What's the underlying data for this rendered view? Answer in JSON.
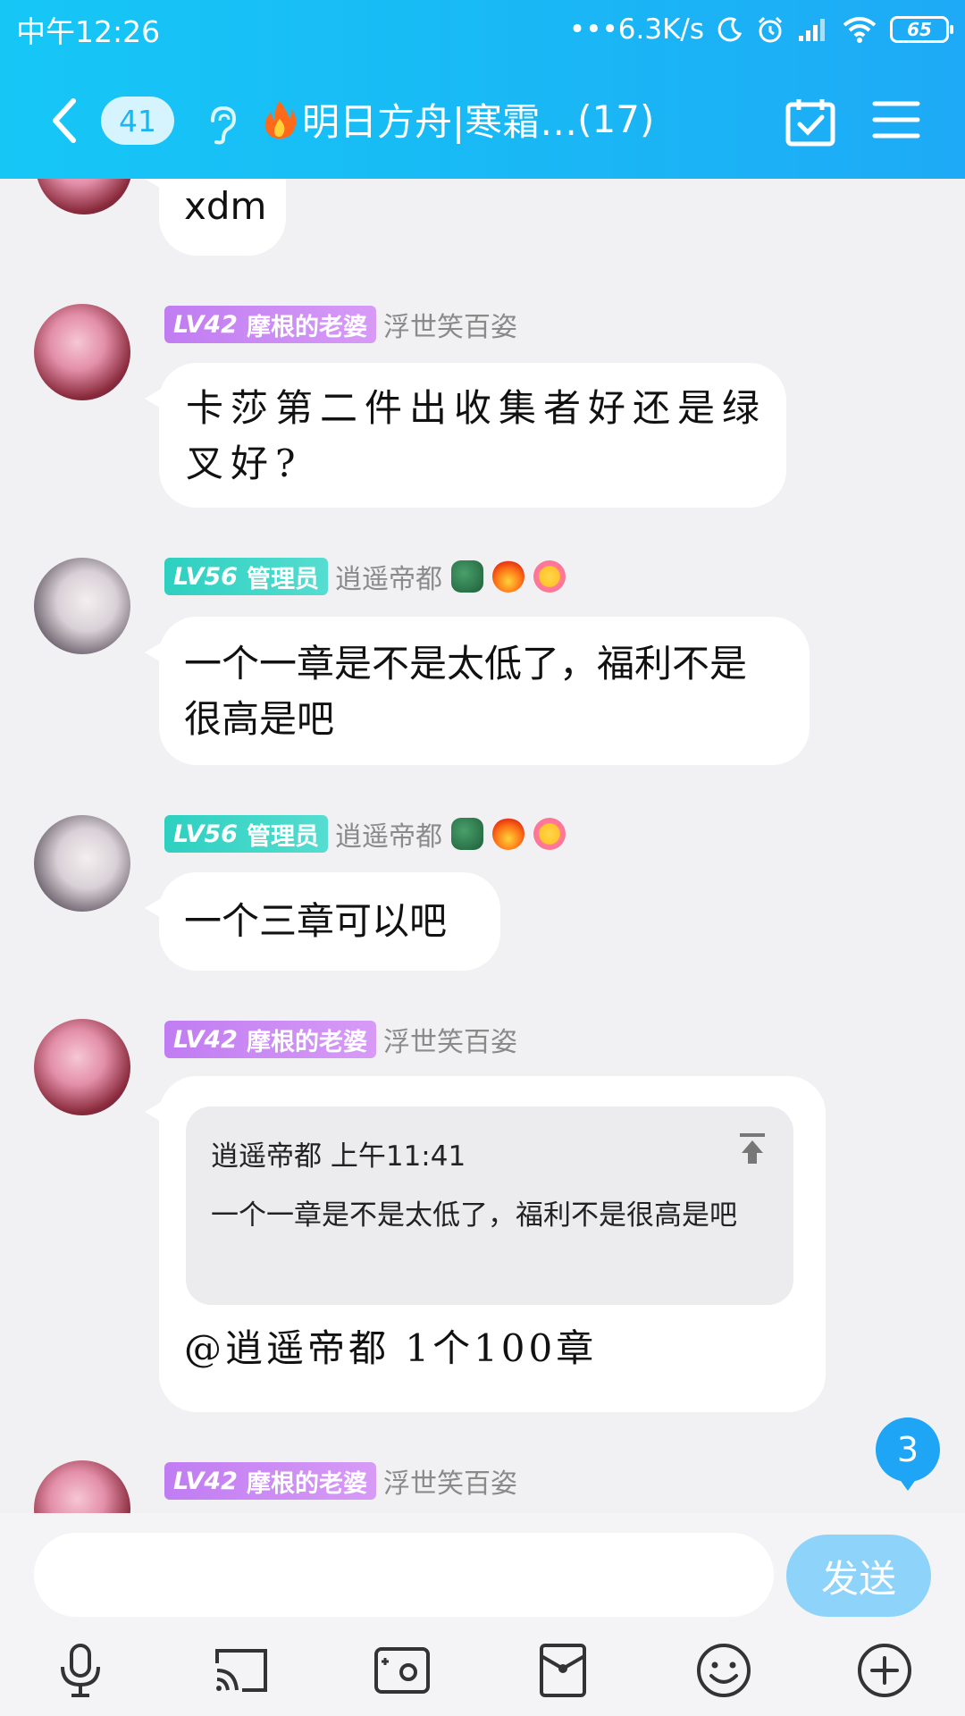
{
  "status_bar": {
    "time": "中午12:26",
    "net_speed": "6.3K/s",
    "battery": "65"
  },
  "header": {
    "unread_count": "41",
    "title": "明日方舟|寒霜…",
    "member_count": "(17)"
  },
  "messages": [
    {
      "text": "xdm"
    },
    {
      "level": "LV42",
      "title": "摩根的老婆",
      "nickname": "浮世笑百姿",
      "text": "卡莎第二件出收集者好还是绿叉好?"
    },
    {
      "level": "LV56",
      "title": "管理员",
      "nickname": "逍遥帝都",
      "text": "一个一章是不是太低了，福利不是很高是吧"
    },
    {
      "level": "LV56",
      "title": "管理员",
      "nickname": "逍遥帝都",
      "text": "一个三章可以吧"
    },
    {
      "level": "LV42",
      "title": "摩根的老婆",
      "nickname": "浮世笑百姿",
      "quote": {
        "author_time": "逍遥帝都 上午11:41",
        "text": "一个一章是不是太低了，福利不是很高是吧"
      },
      "text": "@逍遥帝都 1个100章"
    },
    {
      "level": "LV42",
      "title": "摩根的老婆",
      "nickname": "浮世笑百姿"
    }
  ],
  "new_message_count": "3",
  "input": {
    "placeholder": "",
    "value": "",
    "send_label": "发送"
  },
  "toolbar_icons": [
    "microphone-icon",
    "screen-cast-icon",
    "photo-icon",
    "red-packet-icon",
    "emoji-icon",
    "plus-icon"
  ],
  "colors": {
    "header_start": "#16c7f6",
    "header_end": "#1eaaf6",
    "lv_purple": "#c07cf2",
    "lv_teal": "#2dd0c0",
    "send_button": "#8ed3f9",
    "badge": "#1ea5f5"
  }
}
